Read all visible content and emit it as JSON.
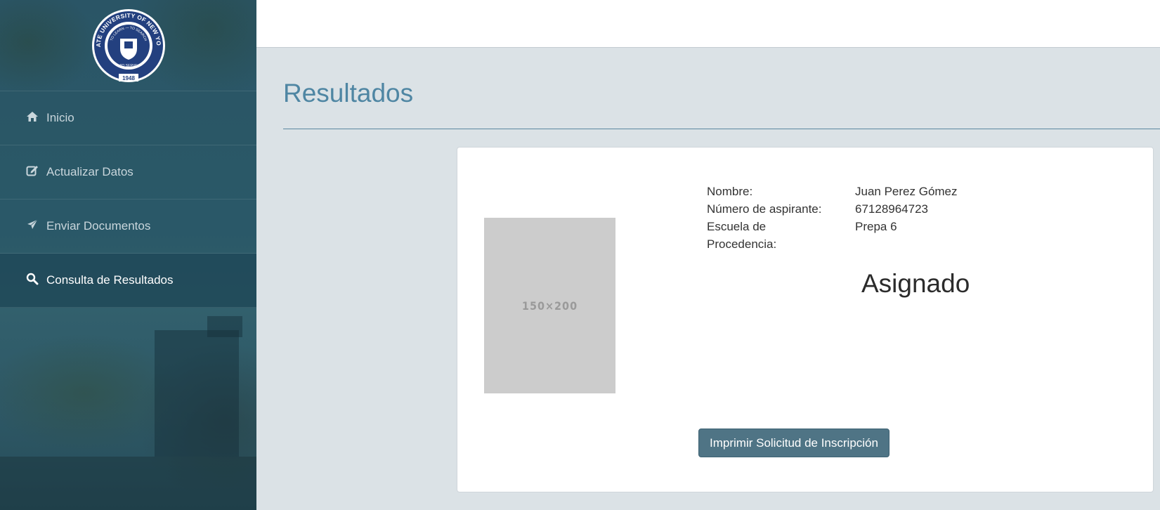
{
  "sidebar": {
    "logo": {
      "ring_text_top": "STATE UNIVERSITY OF NEW YORK",
      "inner_text": "TO LEARN — TO SEARCH",
      "serve_text": "TO SERVE",
      "year": "1948"
    },
    "items": [
      {
        "label": "Inicio",
        "icon": "home-icon"
      },
      {
        "label": "Actualizar Datos",
        "icon": "edit-icon"
      },
      {
        "label": "Enviar Documentos",
        "icon": "send-icon"
      },
      {
        "label": "Consulta de Resultados",
        "icon": "search-icon",
        "active": true
      }
    ]
  },
  "main": {
    "title": "Resultados",
    "photo_placeholder": "150×200",
    "fields": {
      "name_label": "Nombre:",
      "name_value": "Juan Perez Gómez",
      "applicant_label": "Número de aspirante:",
      "applicant_value": "67128964723",
      "school_label": "Escuela de Procedencia:",
      "school_value": "Prepa 6"
    },
    "status": "Asignado",
    "print_button": "Imprimir Solicitud de Inscripción"
  },
  "colors": {
    "accent": "#4f86a3",
    "button": "#4f7485",
    "sidebar": "#2c5a6a"
  }
}
